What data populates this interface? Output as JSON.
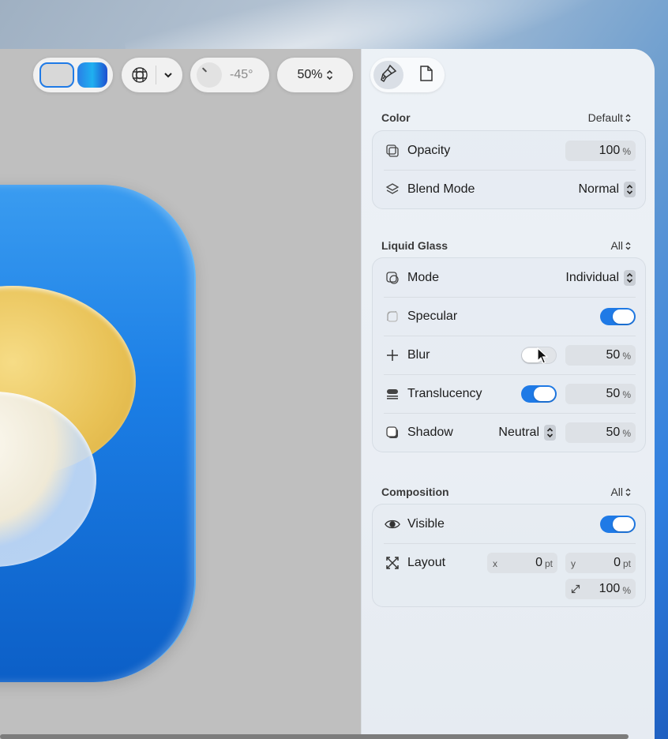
{
  "toolbar": {
    "angle_value": "-45°",
    "zoom_value": "50%"
  },
  "inspector": {
    "tabs": [
      {
        "icon": "paintbrush-icon",
        "active": true
      },
      {
        "icon": "document-icon",
        "active": false
      }
    ],
    "color_section": {
      "title": "Color",
      "selector": "Default",
      "opacity_label": "Opacity",
      "opacity_value": "100",
      "opacity_unit": "%",
      "blend_label": "Blend Mode",
      "blend_value": "Normal"
    },
    "glass_section": {
      "title": "Liquid Glass",
      "selector": "All",
      "mode_label": "Mode",
      "mode_value": "Individual",
      "specular_label": "Specular",
      "specular_on": true,
      "blur_label": "Blur",
      "blur_on": false,
      "blur_value": "50",
      "blur_unit": "%",
      "translucency_label": "Translucency",
      "translucency_on": true,
      "translucency_value": "50",
      "translucency_unit": "%",
      "shadow_label": "Shadow",
      "shadow_mode": "Neutral",
      "shadow_value": "50",
      "shadow_unit": "%"
    },
    "composition_section": {
      "title": "Composition",
      "selector": "All",
      "visible_label": "Visible",
      "visible_on": true,
      "layout_label": "Layout",
      "x_axis": "x",
      "x_value": "0",
      "x_unit": "pt",
      "y_axis": "y",
      "y_value": "0",
      "y_unit": "pt",
      "scale_value": "100",
      "scale_unit": "%"
    }
  },
  "colors": {
    "accent": "#1f7ae6",
    "canvas": "#bfbfbf",
    "icon_blue": "#1c7fe6",
    "sun_yellow": "#e8c155"
  }
}
